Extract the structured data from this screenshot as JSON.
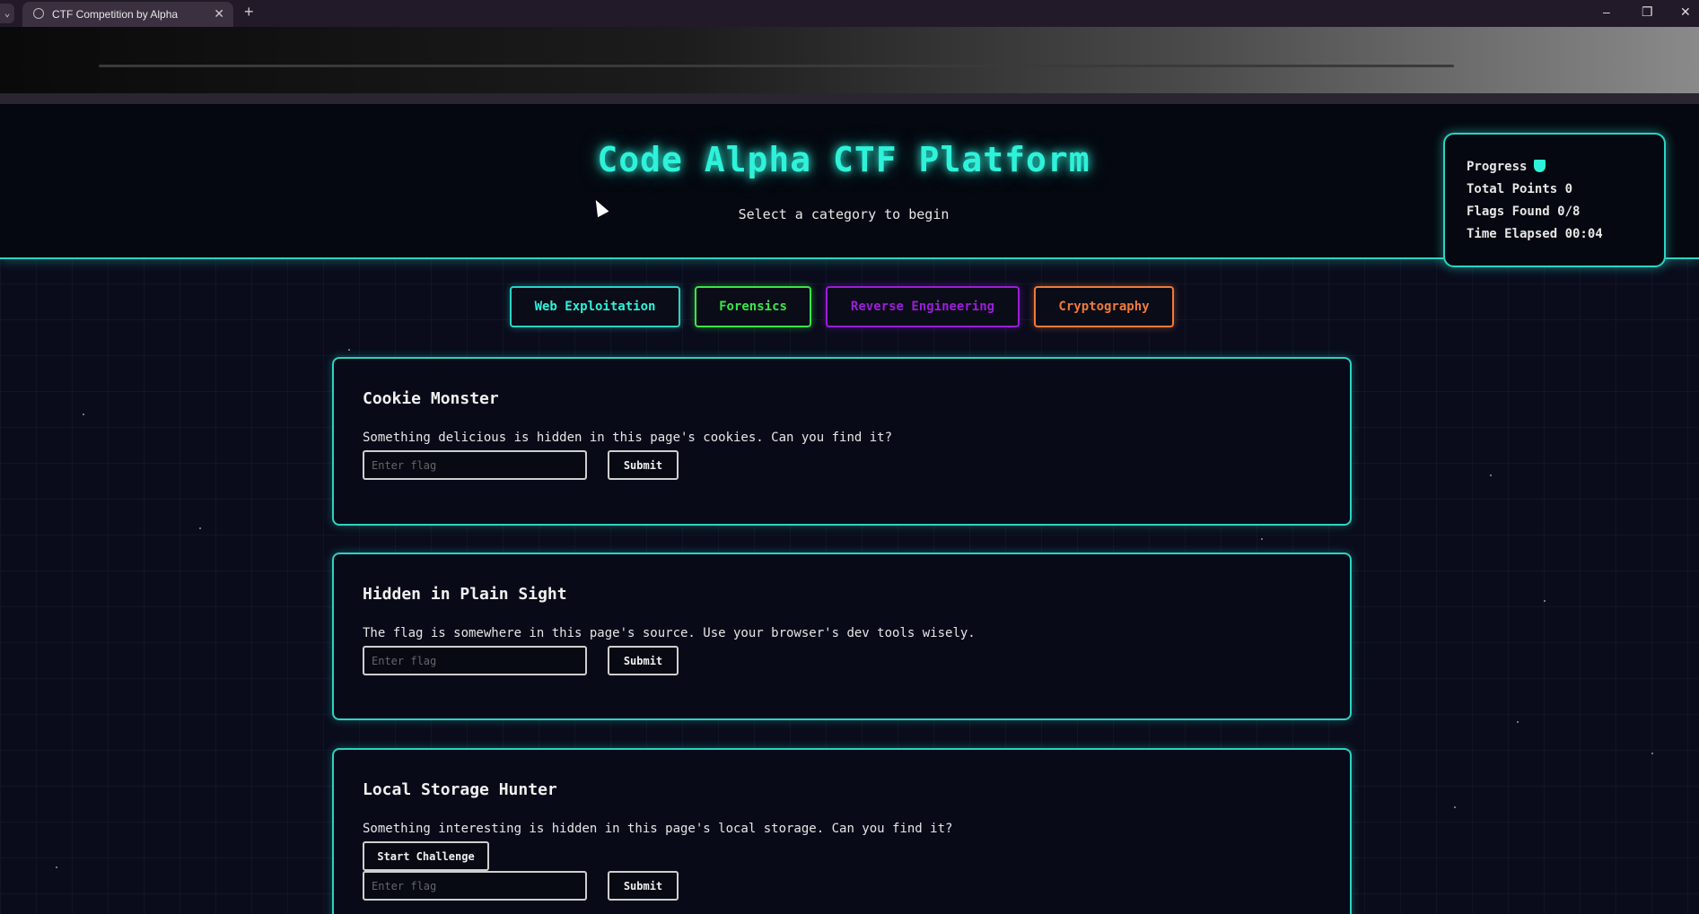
{
  "browser": {
    "tab_title": "CTF Competition by Alpha",
    "tab_close": "✕",
    "new_tab": "+",
    "minimize": "–",
    "restore": "❐",
    "close": "✕"
  },
  "header": {
    "title": "Code Alpha CTF Platform",
    "subtitle": "Select a category to begin"
  },
  "progress": {
    "label": "Progress",
    "total_points": "Total Points 0",
    "flags_found": "Flags Found 0/8",
    "time_elapsed": "Time Elapsed 00:04",
    "icon": "shield-icon"
  },
  "categories": [
    {
      "label": "Web Exploitation",
      "color": "#2ef2d9"
    },
    {
      "label": "Forensics",
      "color": "#39e64a"
    },
    {
      "label": "Reverse Engineering",
      "color": "#9a1fd6"
    },
    {
      "label": "Cryptography",
      "color": "#f07a3a"
    }
  ],
  "challenges": [
    {
      "title": "Cookie Monster",
      "description": "Something delicious is hidden in this page's cookies. Can you find it?",
      "placeholder": "Enter flag",
      "submit": "Submit"
    },
    {
      "title": "Hidden in Plain Sight",
      "description": "The flag is somewhere in this page's source. Use your browser's dev tools wisely.",
      "placeholder": "Enter flag",
      "submit": "Submit"
    },
    {
      "title": "Local Storage Hunter",
      "description": "Something interesting is hidden in this page's local storage. Can you find it?",
      "start": "Start Challenge",
      "placeholder": "Enter flag",
      "submit": "Submit"
    }
  ],
  "colors": {
    "accent": "#2ef2d9",
    "background": "#0a0c1c"
  }
}
